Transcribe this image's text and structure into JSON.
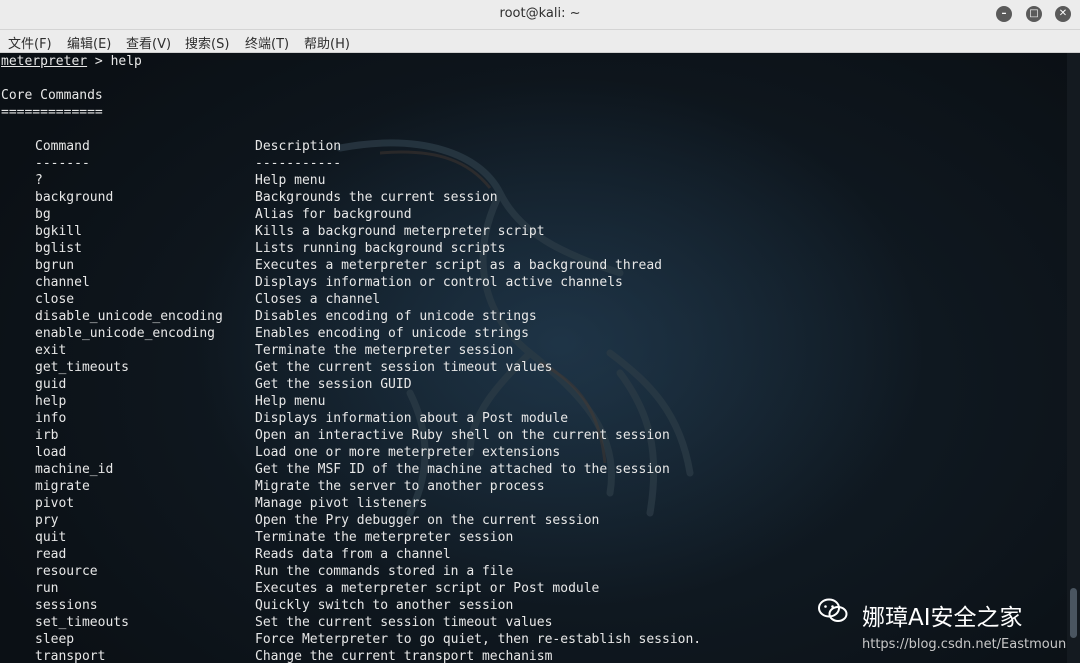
{
  "window": {
    "title": "root@kali: ~"
  },
  "menu": [
    {
      "label": "文件(F)"
    },
    {
      "label": "编辑(E)"
    },
    {
      "label": "查看(V)"
    },
    {
      "label": "搜索(S)"
    },
    {
      "label": "终端(T)"
    },
    {
      "label": "帮助(H)"
    }
  ],
  "terminal": {
    "prompt_name": "meterpreter",
    "prompt_rest": " > help",
    "section_title": "Core Commands",
    "section_rule": "=============",
    "header": {
      "command": "Command",
      "description": "Description"
    },
    "header_rule": {
      "command": "-------",
      "description": "-----------"
    },
    "rows": [
      {
        "command": "?",
        "description": "Help menu"
      },
      {
        "command": "background",
        "description": "Backgrounds the current session"
      },
      {
        "command": "bg",
        "description": "Alias for background"
      },
      {
        "command": "bgkill",
        "description": "Kills a background meterpreter script"
      },
      {
        "command": "bglist",
        "description": "Lists running background scripts"
      },
      {
        "command": "bgrun",
        "description": "Executes a meterpreter script as a background thread"
      },
      {
        "command": "channel",
        "description": "Displays information or control active channels"
      },
      {
        "command": "close",
        "description": "Closes a channel"
      },
      {
        "command": "disable_unicode_encoding",
        "description": "Disables encoding of unicode strings"
      },
      {
        "command": "enable_unicode_encoding",
        "description": "Enables encoding of unicode strings"
      },
      {
        "command": "exit",
        "description": "Terminate the meterpreter session"
      },
      {
        "command": "get_timeouts",
        "description": "Get the current session timeout values"
      },
      {
        "command": "guid",
        "description": "Get the session GUID"
      },
      {
        "command": "help",
        "description": "Help menu"
      },
      {
        "command": "info",
        "description": "Displays information about a Post module"
      },
      {
        "command": "irb",
        "description": "Open an interactive Ruby shell on the current session"
      },
      {
        "command": "load",
        "description": "Load one or more meterpreter extensions"
      },
      {
        "command": "machine_id",
        "description": "Get the MSF ID of the machine attached to the session"
      },
      {
        "command": "migrate",
        "description": "Migrate the server to another process"
      },
      {
        "command": "pivot",
        "description": "Manage pivot listeners"
      },
      {
        "command": "pry",
        "description": "Open the Pry debugger on the current session"
      },
      {
        "command": "quit",
        "description": "Terminate the meterpreter session"
      },
      {
        "command": "read",
        "description": "Reads data from a channel"
      },
      {
        "command": "resource",
        "description": "Run the commands stored in a file"
      },
      {
        "command": "run",
        "description": "Executes a meterpreter script or Post module"
      },
      {
        "command": "sessions",
        "description": "Quickly switch to another session"
      },
      {
        "command": "set_timeouts",
        "description": "Set the current session timeout values"
      },
      {
        "command": "sleep",
        "description": "Force Meterpreter to go quiet, then re-establish session."
      },
      {
        "command": "transport",
        "description": "Change the current transport mechanism"
      }
    ]
  },
  "watermark": {
    "name": "娜璋AI安全之家",
    "url": "https://blog.csdn.net/Eastmoun"
  }
}
